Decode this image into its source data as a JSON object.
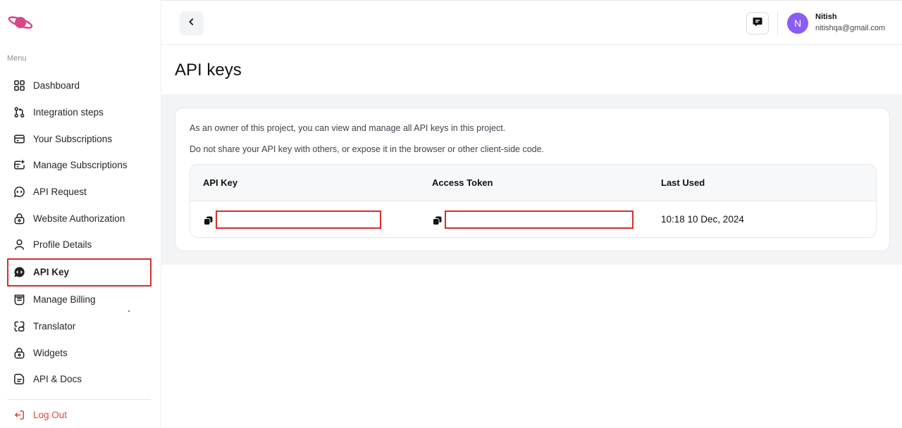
{
  "sidebar": {
    "menu_label": "Menu",
    "items": [
      {
        "label": "Dashboard",
        "icon": "grid-icon"
      },
      {
        "label": "Integration steps",
        "icon": "git-pull-icon"
      },
      {
        "label": "Your Subscriptions",
        "icon": "card-icon"
      },
      {
        "label": "Manage Subscriptions",
        "icon": "card-plus-icon"
      },
      {
        "label": "API Request",
        "icon": "chat-code-icon"
      },
      {
        "label": "Website Authorization",
        "icon": "lock-icon"
      },
      {
        "label": "Profile Details",
        "icon": "user-icon"
      },
      {
        "label": "API Key",
        "icon": "chat-code-filled-icon",
        "active": true
      },
      {
        "label": "Manage Billing",
        "icon": "receipt-icon"
      },
      {
        "label": "Translator",
        "icon": "translate-icon"
      },
      {
        "label": "Widgets",
        "icon": "lock-icon"
      },
      {
        "label": "API & Docs",
        "icon": "doc-icon"
      }
    ],
    "logout_label": "Log Out"
  },
  "header": {
    "user_initial": "N",
    "user_name": "Nitish",
    "user_email": "nitishqa@gmail.com"
  },
  "page": {
    "title": "API keys",
    "note1": "As an owner of this project, you can view and manage all API keys in this project.",
    "note2": "Do not share your API key with others, or expose it in the browser or other client-side code.",
    "table": {
      "headers": [
        "API Key",
        "Access Token",
        "Last Used"
      ],
      "rows": [
        {
          "last_used": "10:18 10 Dec, 2024"
        }
      ]
    }
  },
  "colors": {
    "accent": "#8b5cf6",
    "highlight": "#d92b2b",
    "logout": "#e0463a",
    "logo": "#d9468a"
  }
}
